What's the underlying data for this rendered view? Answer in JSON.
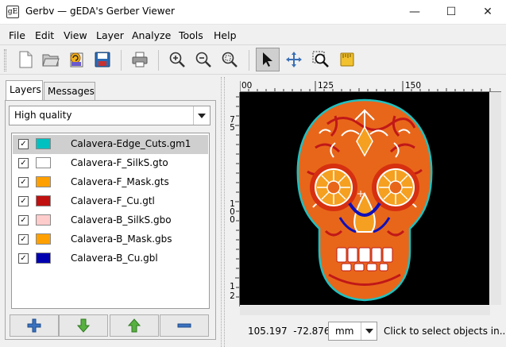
{
  "window": {
    "title": "Gerbv — gEDA's Gerber Viewer",
    "minimize": "—",
    "maximize": "☐",
    "close": "✕"
  },
  "menu": [
    "File",
    "Edit",
    "View",
    "Layer",
    "Analyze",
    "Tools",
    "Help"
  ],
  "toolbar": {
    "buttons": [
      "new-file-icon",
      "open-folder-icon",
      "revert-icon",
      "save-icon",
      "print-icon",
      "zoom-in-icon",
      "zoom-out-icon",
      "zoom-fit-icon",
      "pointer-icon",
      "pan-icon",
      "zoom-area-icon",
      "measure-icon"
    ],
    "active": "pointer-icon"
  },
  "tabs": [
    "Layers",
    "Messages"
  ],
  "active_tab": "Layers",
  "render_quality": "High quality",
  "layers": [
    {
      "name": "Calavera-Edge_Cuts.gm1",
      "color": "#00c0c0",
      "checked": true,
      "selected": true
    },
    {
      "name": "Calavera-F_SilkS.gto",
      "color": "#ffffff",
      "checked": true,
      "selected": false
    },
    {
      "name": "Calavera-F_Mask.gts",
      "color": "#ffa000",
      "checked": true,
      "selected": false
    },
    {
      "name": "Calavera-F_Cu.gtl",
      "color": "#c01010",
      "checked": true,
      "selected": false
    },
    {
      "name": "Calavera-B_SilkS.gbo",
      "color": "#ffcccc",
      "checked": true,
      "selected": false
    },
    {
      "name": "Calavera-B_Mask.gbs",
      "color": "#ffa000",
      "checked": true,
      "selected": false
    },
    {
      "name": "Calavera-B_Cu.gbl",
      "color": "#0000b0",
      "checked": true,
      "selected": false
    }
  ],
  "layer_buttons": [
    "add-layer-icon",
    "move-layer-down-icon",
    "move-layer-up-icon",
    "remove-layer-icon"
  ],
  "ruler": {
    "top": [
      "00",
      "125",
      "150"
    ],
    "left": [
      "7",
      "5",
      "1",
      "0",
      "0",
      "1",
      "2"
    ]
  },
  "status": {
    "coords": "105.197  -72.876",
    "unit": "mm",
    "message": "Click to select objects in..."
  }
}
